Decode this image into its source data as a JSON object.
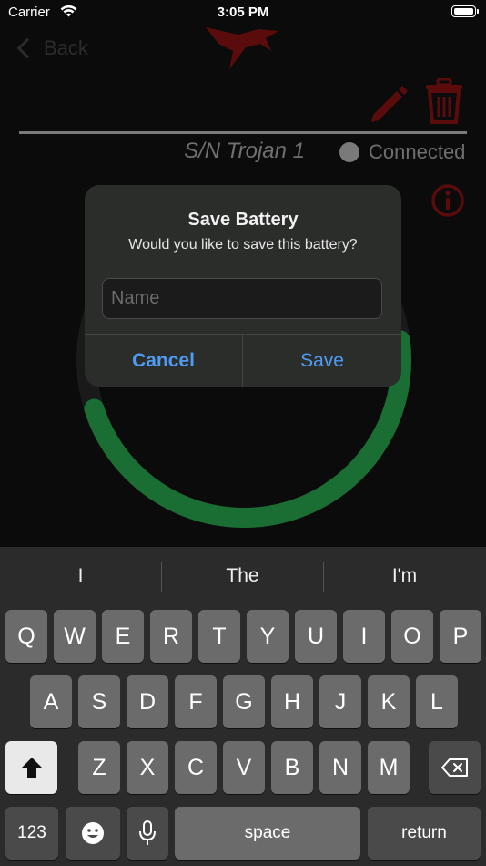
{
  "status_bar": {
    "carrier": "Carrier",
    "time": "3:05 PM"
  },
  "nav": {
    "back_label": "Back"
  },
  "battery_info": {
    "serial": "S/N Trojan 1",
    "connection": "Connected"
  },
  "gauge": {
    "fraction": 0.72
  },
  "alert": {
    "title": "Save Battery",
    "message": "Would you like to save this battery?",
    "input_placeholder": "Name",
    "input_value": "",
    "cancel_label": "Cancel",
    "save_label": "Save"
  },
  "keyboard": {
    "suggestions": [
      "I",
      "The",
      "I'm"
    ],
    "row1": [
      "Q",
      "W",
      "E",
      "R",
      "T",
      "Y",
      "U",
      "I",
      "O",
      "P"
    ],
    "row2": [
      "A",
      "S",
      "D",
      "F",
      "G",
      "H",
      "J",
      "K",
      "L"
    ],
    "row3": [
      "Z",
      "X",
      "C",
      "V",
      "B",
      "N",
      "M"
    ],
    "numbers_label": "123",
    "space_label": "space",
    "return_label": "return"
  },
  "colors": {
    "accent_red": "#7d1414",
    "gauge_green": "#1d8a38",
    "link_blue": "#4f9bf2"
  },
  "icons": [
    "wifi-icon",
    "logo-icon",
    "pencil-icon",
    "trash-icon",
    "info-icon",
    "shift-icon",
    "backspace-icon",
    "emoji-icon",
    "microphone-icon"
  ]
}
